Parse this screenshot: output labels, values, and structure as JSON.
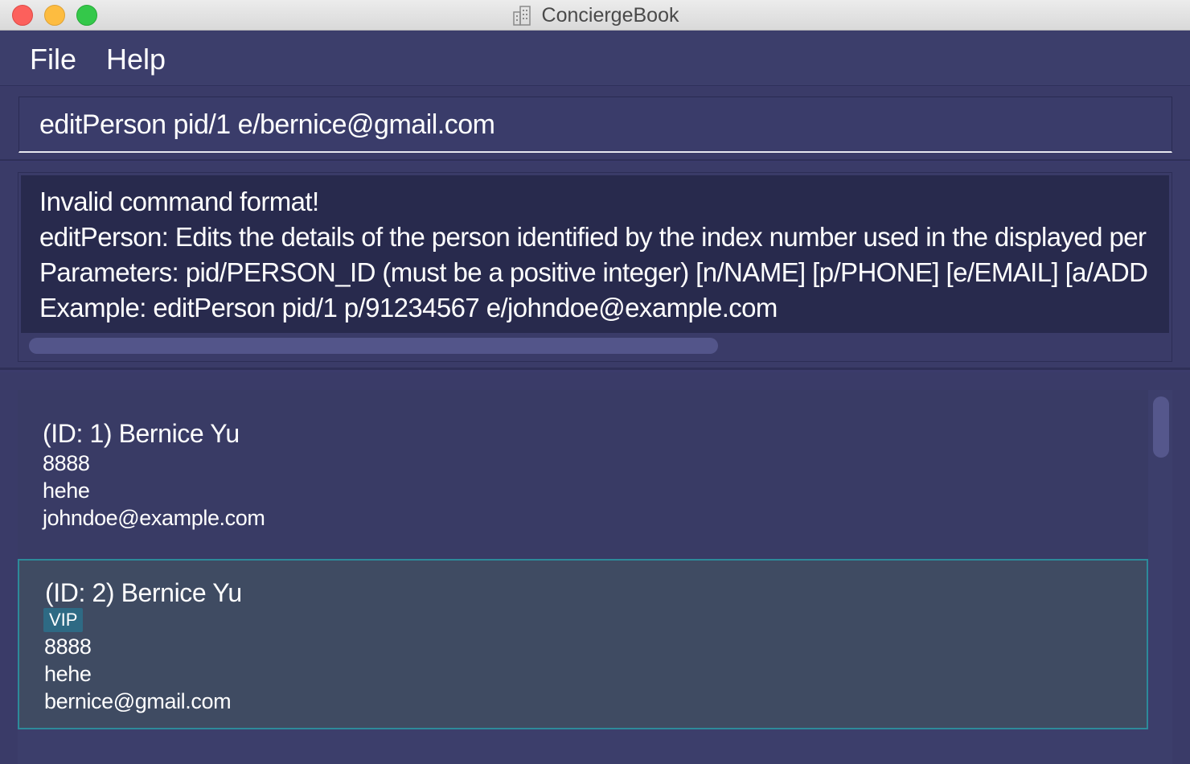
{
  "window": {
    "title": "ConciergeBook",
    "icon": "building-icon"
  },
  "menu": {
    "items": [
      {
        "label": "File"
      },
      {
        "label": "Help"
      }
    ]
  },
  "command": {
    "value": "editPerson pid/1 e/bernice@gmail.com"
  },
  "result": {
    "lines": [
      "Invalid command format!",
      "editPerson: Edits the details of the person identified by the index number used in the displayed per",
      "Parameters: pid/PERSON_ID (must be a positive integer) [n/NAME] [p/PHONE] [e/EMAIL] [a/ADD",
      "Example: editPerson pid/1 p/91234567 e/johndoe@example.com"
    ]
  },
  "persons": [
    {
      "name": "(ID: 1) Bernice Yu",
      "tags": [],
      "phone": "8888",
      "address": "hehe",
      "email": "johndoe@example.com"
    },
    {
      "name": "(ID: 2) Bernice Yu",
      "tags": [
        "VIP"
      ],
      "phone": "8888",
      "address": "hehe",
      "email": "bernice@gmail.com"
    }
  ],
  "colors": {
    "background": "#3c3e6b",
    "result_bg": "#282a4d",
    "selected_card_bg": "#3f4b62",
    "selected_border": "#2d8a9a",
    "tag_bg": "#2e6a84"
  }
}
